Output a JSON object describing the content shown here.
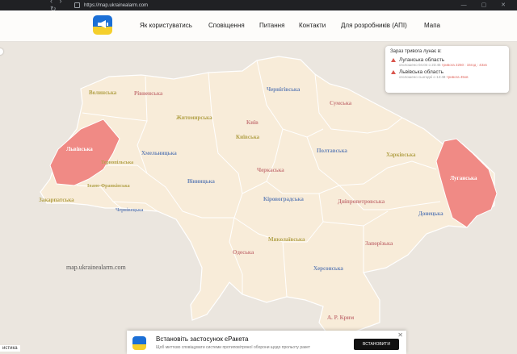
{
  "browser": {
    "nav": "‹ › ↻",
    "url": "https://map.ukrainealarm.com",
    "controls": "— ▢ ✕"
  },
  "header": {
    "nav": [
      {
        "label": "Як користуватись"
      },
      {
        "label": "Сповіщення"
      },
      {
        "label": "Питання"
      },
      {
        "label": "Контакти"
      },
      {
        "label": "Для розробників (АПІ)"
      },
      {
        "label": "Мапа"
      }
    ]
  },
  "alerts": {
    "title": "Зараз тривога лунає в:",
    "items": [
      {
        "name": "Луганська область",
        "meta": "оголошено 04.04 о 23:45",
        "duration": "тривога 2250 : 15год : 43хв"
      },
      {
        "name": "Львівська область",
        "meta": "оголошено сьогодні о 14:48",
        "duration": "тривога 45хв"
      }
    ]
  },
  "map": {
    "watermark": "map.ukrainealarm.com",
    "alert_color": "#f08a85",
    "base_color": "#f8ecd9",
    "regions": [
      {
        "name": "Волинська",
        "color": "#b3a24a"
      },
      {
        "name": "Рівненська",
        "color": "#c97e7e"
      },
      {
        "name": "Житомирська",
        "color": "#b3a24a"
      },
      {
        "name": "Чернігівська",
        "color": "#6b86b8"
      },
      {
        "name": "Сумська",
        "color": "#c97e7e"
      },
      {
        "name": "Київ",
        "color": "#c97e7e"
      },
      {
        "name": "Київська",
        "color": "#b3a24a"
      },
      {
        "name": "Львівська",
        "color": "#ffffff"
      },
      {
        "name": "Хмельницька",
        "color": "#6b86b8"
      },
      {
        "name": "Тернопільська",
        "color": "#b3a24a"
      },
      {
        "name": "Вінницька",
        "color": "#6b86b8"
      },
      {
        "name": "Черкаська",
        "color": "#c97e7e"
      },
      {
        "name": "Полтавська",
        "color": "#6b86b8"
      },
      {
        "name": "Харківська",
        "color": "#b3a24a"
      },
      {
        "name": "Луганська",
        "color": "#ffffff"
      },
      {
        "name": "Закарпатська",
        "color": "#b3a24a"
      },
      {
        "name": "Івано-Франківська",
        "color": "#b3a24a"
      },
      {
        "name": "Чернівецька",
        "color": "#6b86b8"
      },
      {
        "name": "Кіровоградська",
        "color": "#6b86b8"
      },
      {
        "name": "Дніпропетровська",
        "color": "#c97e7e"
      },
      {
        "name": "Донецька",
        "color": "#6b86b8"
      },
      {
        "name": "Миколаївська",
        "color": "#b3a24a"
      },
      {
        "name": "Запорізька",
        "color": "#c97e7e"
      },
      {
        "name": "Одеська",
        "color": "#c97e7e"
      },
      {
        "name": "Херсонська",
        "color": "#6b86b8"
      },
      {
        "name": "А. Р. Крим",
        "color": "#c97e7e"
      }
    ]
  },
  "banner": {
    "title": "Встановіть застосунок єРакета",
    "subtitle": "Щоб миттєво сповіщувати системи протиповітряної оборони щодо прольоту ракет",
    "install": "ВСТАНОВИТИ",
    "close": "✕"
  },
  "left_badge": "истика"
}
